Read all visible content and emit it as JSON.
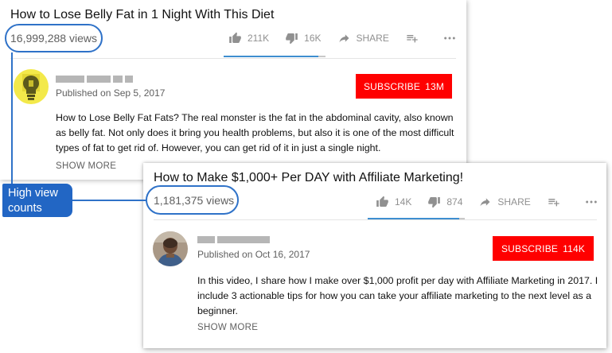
{
  "annotation": {
    "callout_line1": "High view",
    "callout_line2": "counts",
    "color": "#2266c4"
  },
  "videos": [
    {
      "title": "How to Lose Belly Fat in 1 Night With This Diet",
      "views": "16,999,288 views",
      "likes": "211K",
      "dislikes": "16K",
      "share_label": "SHARE",
      "like_ratio": 0.93,
      "avatar_icon": "lightbulb-icon",
      "published": "Published on Sep 5, 2017",
      "subscribe_label": "SUBSCRIBE",
      "subscriber_count": "13M",
      "description_lines": [
        "How to Lose Belly Fat Fats? The real monster is the fat in the abdominal cavity, also known",
        "as belly fat. Not only does it bring you health problems, but also it is one of the most difficult",
        "types of fat to get rid of. However, you can get rid of it in just a single night."
      ],
      "show_more": "SHOW MORE"
    },
    {
      "title": "How to Make $1,000+ Per DAY with Affiliate Marketing!",
      "views": "1,181,375 views",
      "likes": "14K",
      "dislikes": "874",
      "share_label": "SHARE",
      "like_ratio": 0.94,
      "avatar_icon": "person-photo-icon",
      "published": "Published on Oct 16, 2017",
      "subscribe_label": "SUBSCRIBE",
      "subscriber_count": "114K",
      "description_lines": [
        "In this video, I share how I make over $1,000 profit per day with Affiliate Marketing in 2017. I",
        "include 3 actionable tips for how you can take your affiliate marketing to the next level as a",
        "beginner."
      ],
      "show_more": "SHOW MORE"
    }
  ],
  "colors": {
    "subscribe": "#ff0000",
    "like_bar": "#3e8ed0",
    "dislike_bar": "#c8c8c8"
  }
}
